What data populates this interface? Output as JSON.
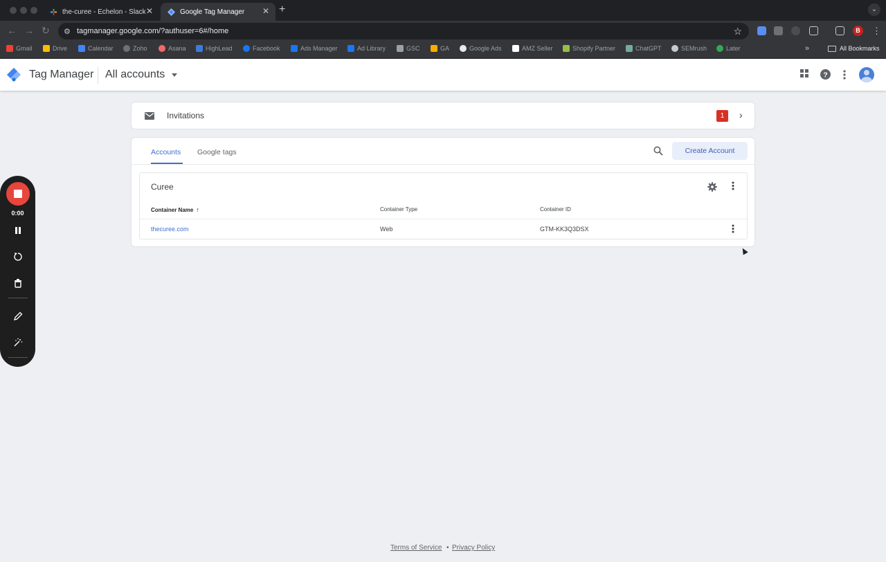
{
  "browser": {
    "tabs": [
      {
        "title": "the-curee - Echelon - Slack",
        "close": "✕"
      },
      {
        "title": "Google Tag Manager",
        "close": "✕"
      }
    ],
    "new_tab": "+",
    "tab_menu": "⌄",
    "url": "tagmanager.google.com/?authuser=6#/home",
    "profile_letter": "B",
    "bookmarks": [
      "Gmail",
      "Drive",
      "Calendar",
      "Zoho",
      "Asana",
      "HighLead",
      "Facebook",
      "Ads Manager",
      "Ad Library",
      "GSC",
      "GA",
      "Google Ads",
      "AMZ Seller",
      "Shopify Partner",
      "ChatGPT",
      "SEMrush",
      "Later"
    ],
    "bookmarks_more": "»",
    "all_bookmarks": "All Bookmarks"
  },
  "app": {
    "title": "Tag Manager",
    "account_selector": "All accounts"
  },
  "invitations": {
    "label": "Invitations",
    "count": "1"
  },
  "accounts_panel": {
    "tabs": [
      "Accounts",
      "Google tags"
    ],
    "create_button": "Create Account",
    "account": {
      "name": "Curee",
      "columns": [
        "Container Name",
        "Container Type",
        "Container ID"
      ],
      "sort_arrow": "↑",
      "rows": [
        {
          "name": "thecuree.com",
          "type": "Web",
          "id": "GTM-KK3Q3DSX"
        }
      ]
    }
  },
  "footer": {
    "terms": "Terms of Service",
    "dot": "•",
    "privacy": "Privacy Policy"
  },
  "recorder": {
    "time": "0:00"
  },
  "colors": {
    "accent": "#3f6fd1",
    "badge": "#d93025",
    "record": "#e8453c"
  }
}
